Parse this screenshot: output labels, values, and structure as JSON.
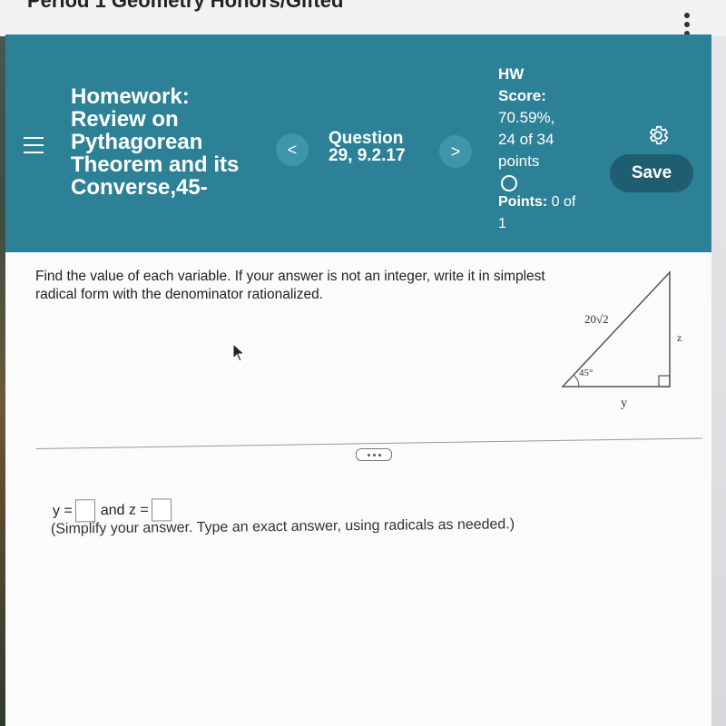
{
  "course": {
    "title": "Period 1 Geometry Honors/Gifted"
  },
  "header": {
    "menu_icon": "hamburger-menu-icon",
    "assignment_title": "Homework: Review on Pythagorean Theorem and its Converse,45-",
    "prev_label": "<",
    "next_label": ">",
    "question_label": "Question 29, 9.2.17",
    "hw_score_label": "HW Score:",
    "hw_score_value": "70.59%, 24 of 34 points",
    "points_label": "Points:",
    "points_value": "0 of 1",
    "settings_icon": "gear-icon",
    "save_label": "Save"
  },
  "question": {
    "prompt": "Find the value of each variable. If your answer is not an integer, write it in simplest radical form with the denominator rationalized.",
    "figure": {
      "hypotenuse_label": "20√2",
      "vertical_side_label": "z",
      "base_label": "y",
      "angle_label": "45°"
    }
  },
  "answer": {
    "y_label": "y =",
    "y_value": "",
    "and_z_label": "and z =",
    "z_value": "",
    "hint": "(Simplify your answer. Type an exact answer, using radicals as needed.)"
  }
}
